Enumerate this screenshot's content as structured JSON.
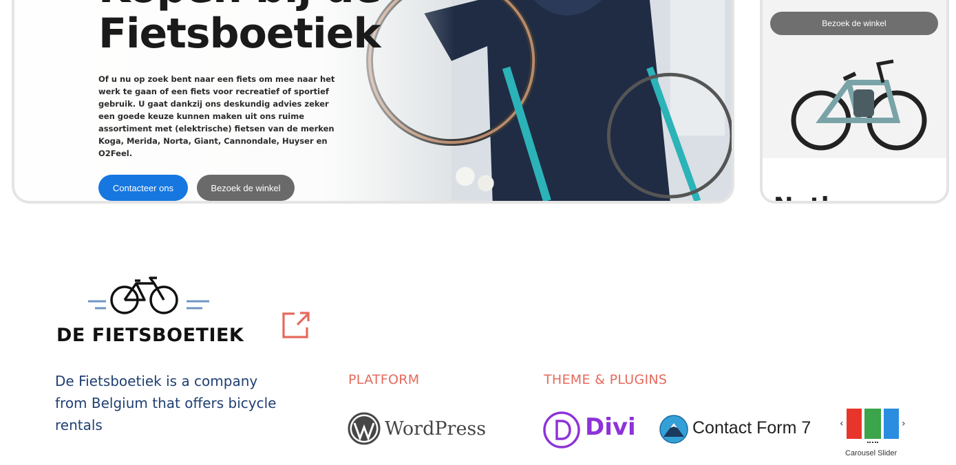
{
  "hero": {
    "title_line1": "Kopen bij de",
    "title_line2": "Fietsboetiek",
    "text": "Of u nu op zoek bent naar een fiets om mee naar het werk te gaan of een fiets voor recreatief of sportief gebruik. U gaat dankzij ons deskundig advies zeker een goede keuze kunnen maken uit ons ruime assortiment met (elektrische) fietsen van de merken Koga, Merida, Norta, Giant, Cannondale, Huyser en O2Feel.",
    "contact_label": "Contacteer ons",
    "visit_label": "Bezoek de winkel"
  },
  "side_card": {
    "visit_label": "Bezoek de winkel",
    "heading": "Nutl..."
  },
  "project": {
    "logo_text": "DE FIETSBOETIEK",
    "description": "De Fietsboetiek is a company from Belgium that offers bicycle rentals",
    "platform_label": "PLATFORM",
    "theme_label": "THEME & PLUGINS",
    "wordpress_text": "WordPress",
    "divi_text": "Divi",
    "cf7_text": "Contact Form 7",
    "carousel_text": "Carousel Slider"
  },
  "colors": {
    "accent": "#e46a5c",
    "description": "#1f3f72",
    "contact_button": "#1677e0",
    "visit_button": "#6a6a6a",
    "divi": "#8d33d9"
  }
}
